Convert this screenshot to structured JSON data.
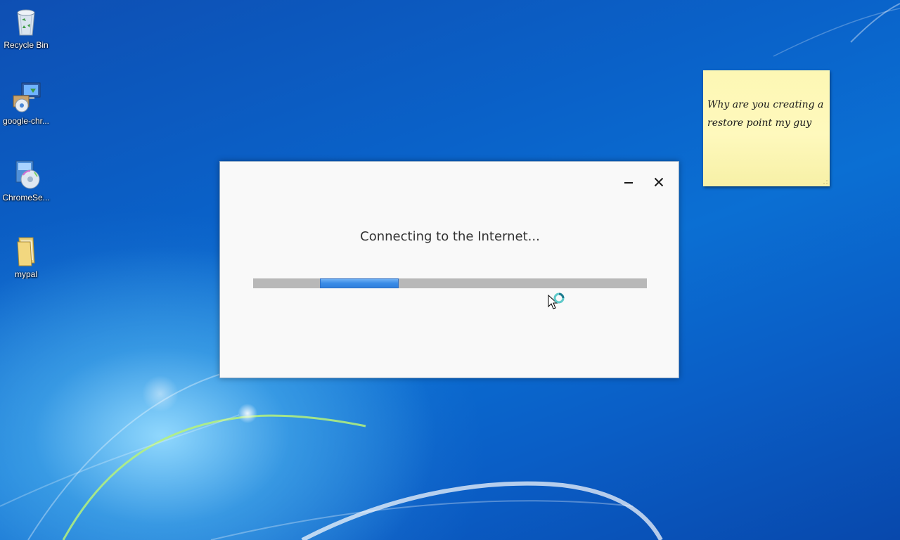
{
  "desktop": {
    "icons": [
      {
        "label": "Recycle Bin",
        "icon": "recycle-bin-icon"
      },
      {
        "label": "google-chr...",
        "icon": "installer-icon"
      },
      {
        "label": "ChromeSe...",
        "icon": "setup-disc-icon"
      },
      {
        "label": "mypal",
        "icon": "folder-icon"
      }
    ]
  },
  "sticky_note": {
    "text": "Why are you creating a restore point my guy",
    "color": "#fef9bd"
  },
  "dialog": {
    "message": "Connecting to the Internet...",
    "minimize_icon": "minimize-icon",
    "close_icon": "close-icon",
    "progress": {
      "style": "indeterminate",
      "chunk_start": 0.17,
      "chunk_end": 0.37,
      "accent_color": "#3a8be6",
      "track_color": "#b8b8b8"
    }
  },
  "cursor": {
    "icon": "busy-pointer-icon"
  }
}
